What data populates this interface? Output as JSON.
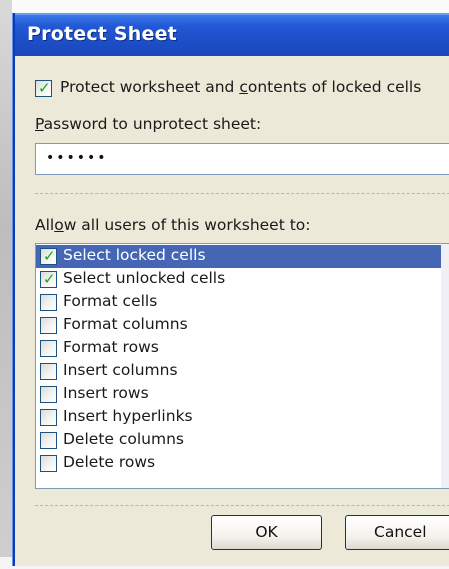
{
  "dialog": {
    "title": "Protect Sheet",
    "protect_checkbox": {
      "checked": true,
      "label_before": "Protect worksheet and ",
      "label_underlined": "c",
      "label_after": "ontents of locked cells"
    },
    "password": {
      "label_underlined": "P",
      "label_after": "assword to unprotect sheet:",
      "value": "••••••"
    },
    "allow": {
      "label_before": "All",
      "label_underlined": "o",
      "label_after": "w all users of this worksheet to:"
    },
    "permissions": [
      {
        "label": "Select locked cells",
        "checked": true,
        "selected": true
      },
      {
        "label": "Select unlocked cells",
        "checked": true,
        "selected": false
      },
      {
        "label": "Format cells",
        "checked": false,
        "selected": false
      },
      {
        "label": "Format columns",
        "checked": false,
        "selected": false
      },
      {
        "label": "Format rows",
        "checked": false,
        "selected": false
      },
      {
        "label": "Insert columns",
        "checked": false,
        "selected": false
      },
      {
        "label": "Insert rows",
        "checked": false,
        "selected": false
      },
      {
        "label": "Insert hyperlinks",
        "checked": false,
        "selected": false
      },
      {
        "label": "Delete columns",
        "checked": false,
        "selected": false
      },
      {
        "label": "Delete rows",
        "checked": false,
        "selected": false
      }
    ],
    "ok_label": "OK",
    "cancel_label": "Cancel",
    "colors": {
      "title_bar": "#1d4fc8",
      "dialog_bg": "#ece9d8",
      "selection": "#4566b4",
      "check": "#21a121"
    },
    "icons": {
      "check": "check-icon"
    }
  }
}
